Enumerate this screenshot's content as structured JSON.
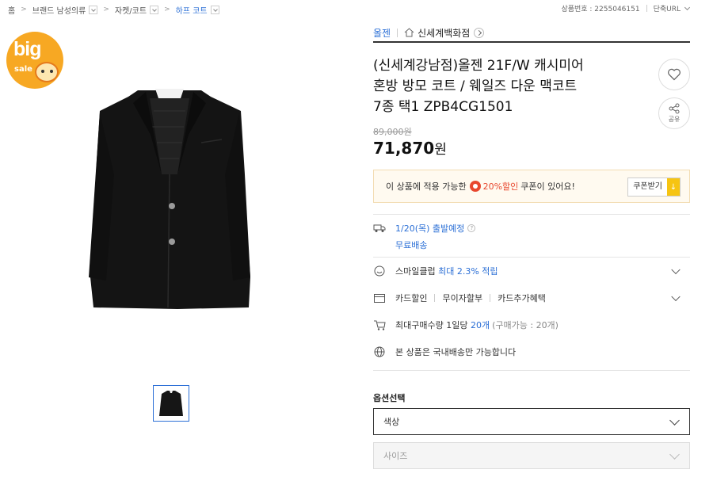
{
  "breadcrumb": {
    "home": "홈",
    "cat1": "브랜드 남성의류",
    "cat2": "자켓/코트",
    "cat3": "하프 코트"
  },
  "header": {
    "product_no": "상품번호 : 2255046151",
    "short_url": "단축URL"
  },
  "badge": {
    "big": "big",
    "sale": "sale"
  },
  "seller": {
    "brand": "올젠",
    "store": "신세계백화점"
  },
  "product": {
    "title_line1": "(신세계강남점)올젠 21F/W 캐시미어",
    "title_line2": "혼방 방모 코트 / 웨일즈 다운 맥코트",
    "title_line3": "7종 택1 ZPB4CG1501",
    "original_price": "89,000원",
    "sale_price": "71,870",
    "currency": "원"
  },
  "actions": {
    "share": "공유"
  },
  "coupon": {
    "prefix": "이 상품에 적용 가능한",
    "percent": "20%할인",
    "suffix": "쿠폰이 있어요!",
    "button": "쿠폰받기"
  },
  "shipping": {
    "date": "1/20(목) 출발예정",
    "free": "무료배송"
  },
  "smile_club": {
    "label": "스마일클럽",
    "highlight": "최대 2.3% 적립"
  },
  "card": {
    "discount": "카드할인",
    "installment": "무이자할부",
    "benefit": "카드추가혜택"
  },
  "max_purchase": {
    "label": "최대구매수량 1일당",
    "value": "20개",
    "note": "(구매가능 : 20개)"
  },
  "domestic": {
    "text": "본 상품은 국내배송만 가능합니다"
  },
  "options": {
    "title": "옵션선택",
    "color": "색상",
    "size": "사이즈"
  },
  "colors": {
    "accent": "#2b6fd6",
    "coupon_red": "#e8472e",
    "badge_orange": "#f7a823"
  }
}
